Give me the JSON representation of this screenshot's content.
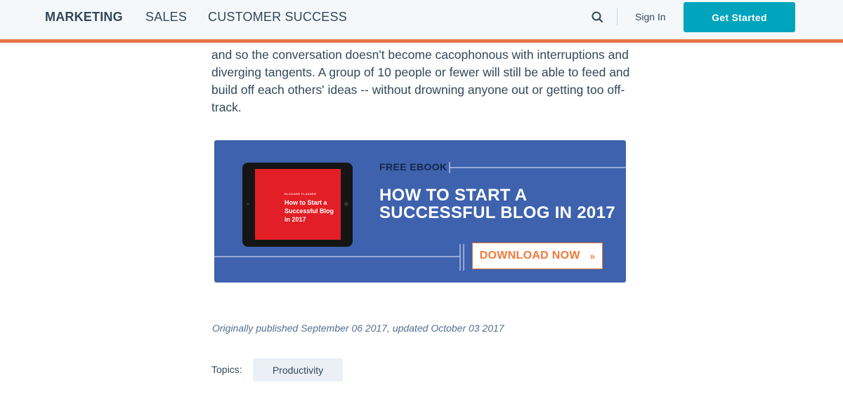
{
  "header": {
    "nav": [
      {
        "label": "MARKETING",
        "active": true
      },
      {
        "label": "SALES",
        "active": false
      },
      {
        "label": "CUSTOMER SUCCESS",
        "active": false
      }
    ],
    "search_icon": "search-icon",
    "sign_in": "Sign In",
    "cta": "Get Started"
  },
  "article": {
    "paragraph": "and so the conversation doesn't become cacophonous with interruptions and diverging tangents. A group of 10 people or fewer will still be able to feed and build off each others' ideas -- without drowning anyone out or getting too off-track."
  },
  "banner": {
    "kicker": "FREE EBOOK",
    "title": "HOW TO START A SUCCESSFUL BLOG IN 2017",
    "tablet_kicker": "BLOGGER PLANNER",
    "tablet_title": "How to Start a Successful Blog in 2017",
    "button": "DOWNLOAD NOW",
    "button_icon": "chevron-right-icon"
  },
  "meta": {
    "published": "Originally published September 06 2017, updated October 03 2017",
    "topics_label": "Topics:",
    "topics": [
      "Productivity"
    ]
  },
  "colors": {
    "accent_bar": "#e8744a",
    "cta_bg": "#00a4bd",
    "banner_bg": "#3e62ad",
    "download_text": "#f07a3c"
  }
}
